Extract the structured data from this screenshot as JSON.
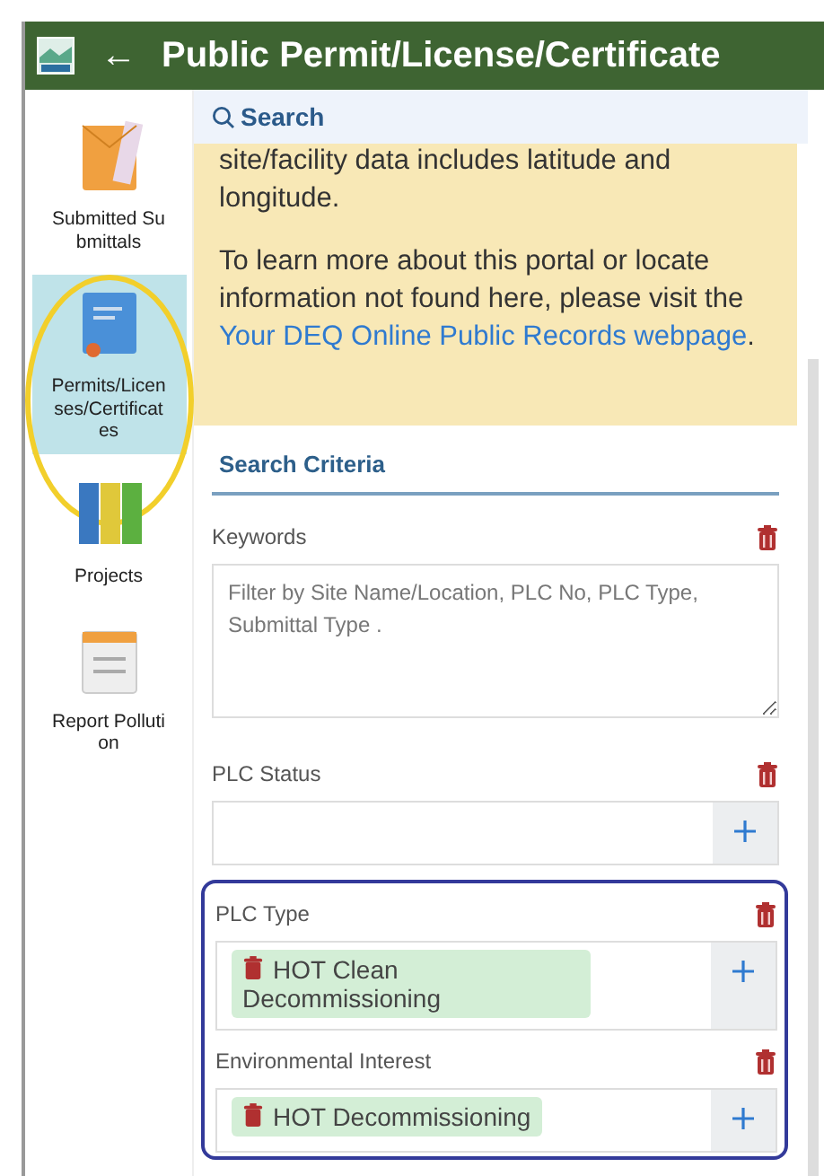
{
  "header": {
    "title": "Public Permit/License/Certificate",
    "back": "←"
  },
  "sidebar": {
    "items": [
      {
        "label": "Submitted Submittals",
        "selected": false,
        "highlighted": false
      },
      {
        "label": "Permits/Licenses/Certificates",
        "selected": true,
        "highlighted": true
      },
      {
        "label": "Projects",
        "selected": false,
        "highlighted": false
      },
      {
        "label": "Report Pollution",
        "selected": false,
        "highlighted": false
      }
    ]
  },
  "search_tab": {
    "label": "Search"
  },
  "notice": {
    "lines": [
      "site/facility data includes latitude and longitude."
    ],
    "text": "To learn more about this portal or locate information not found here, please visit the ",
    "link": "Your DEQ Online Public Records webpage",
    "after": "."
  },
  "criteria": {
    "title": "Search Criteria",
    "fields": [
      {
        "label": "Keywords",
        "kind": "textarea",
        "placeholder": "Filter by Site Name/Location, PLC No, PLC Type, Submittal Type .",
        "highlighted": false
      },
      {
        "label": "PLC Status",
        "kind": "select",
        "highlighted": false
      },
      {
        "label": "PLC Type",
        "kind": "select",
        "chips": [
          "HOT Clean Decommissioning"
        ],
        "highlighted": true
      },
      {
        "label": "Environmental Interest",
        "kind": "select",
        "chips": [
          "HOT Decommissioning"
        ],
        "highlighted": true
      }
    ]
  }
}
